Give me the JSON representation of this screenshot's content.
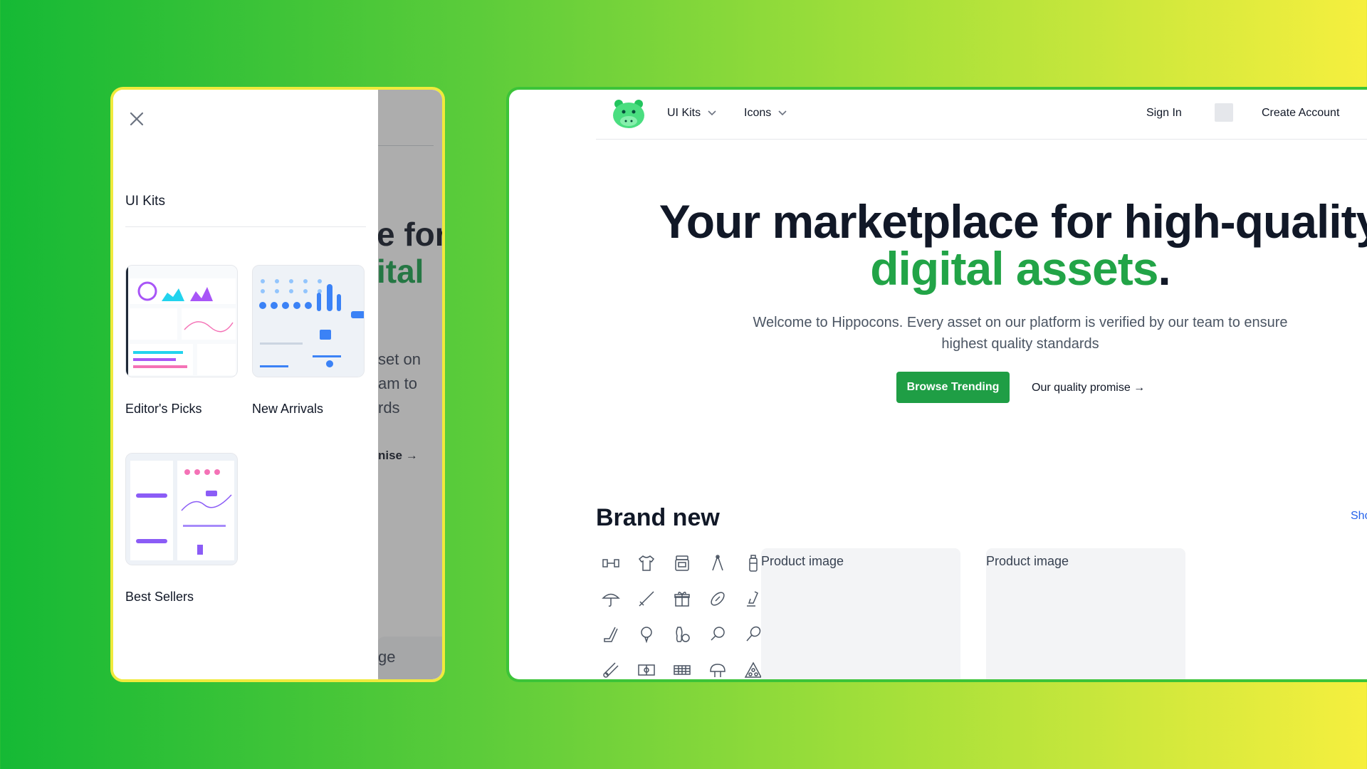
{
  "mobile": {
    "drawer": {
      "title": "UI Kits",
      "kits": [
        {
          "label": "Editor's Picks"
        },
        {
          "label": "New Arrivals"
        },
        {
          "label": "Best Sellers"
        }
      ]
    },
    "background": {
      "heading_line1": "e for",
      "heading_line2": "ital",
      "para_lines": [
        "set on",
        "am to",
        "rds"
      ],
      "link": "nise →",
      "pill": "ge"
    }
  },
  "desktop": {
    "nav": {
      "menu": [
        {
          "label": "UI Kits"
        },
        {
          "label": "Icons"
        }
      ],
      "sign_in": "Sign In",
      "create_account": "Create Account"
    },
    "hero": {
      "title_part1": "Your marketplace for high-quality ",
      "title_highlight": "digital assets",
      "title_end": ".",
      "subtitle": "Welcome to Hippocons. Every asset on our platform is verified by our team to ensure highest quality standards",
      "primary_button": "Browse Trending",
      "secondary_link": "Our quality promise →"
    },
    "brand_new": {
      "title": "Brand new",
      "show_link": "Sho",
      "products": [
        {
          "alt": "Product image"
        },
        {
          "alt": "Product image"
        }
      ]
    }
  },
  "colors": {
    "accent_green": "#1f9e45",
    "highlight_green": "#22a447",
    "link_blue": "#2563eb"
  }
}
